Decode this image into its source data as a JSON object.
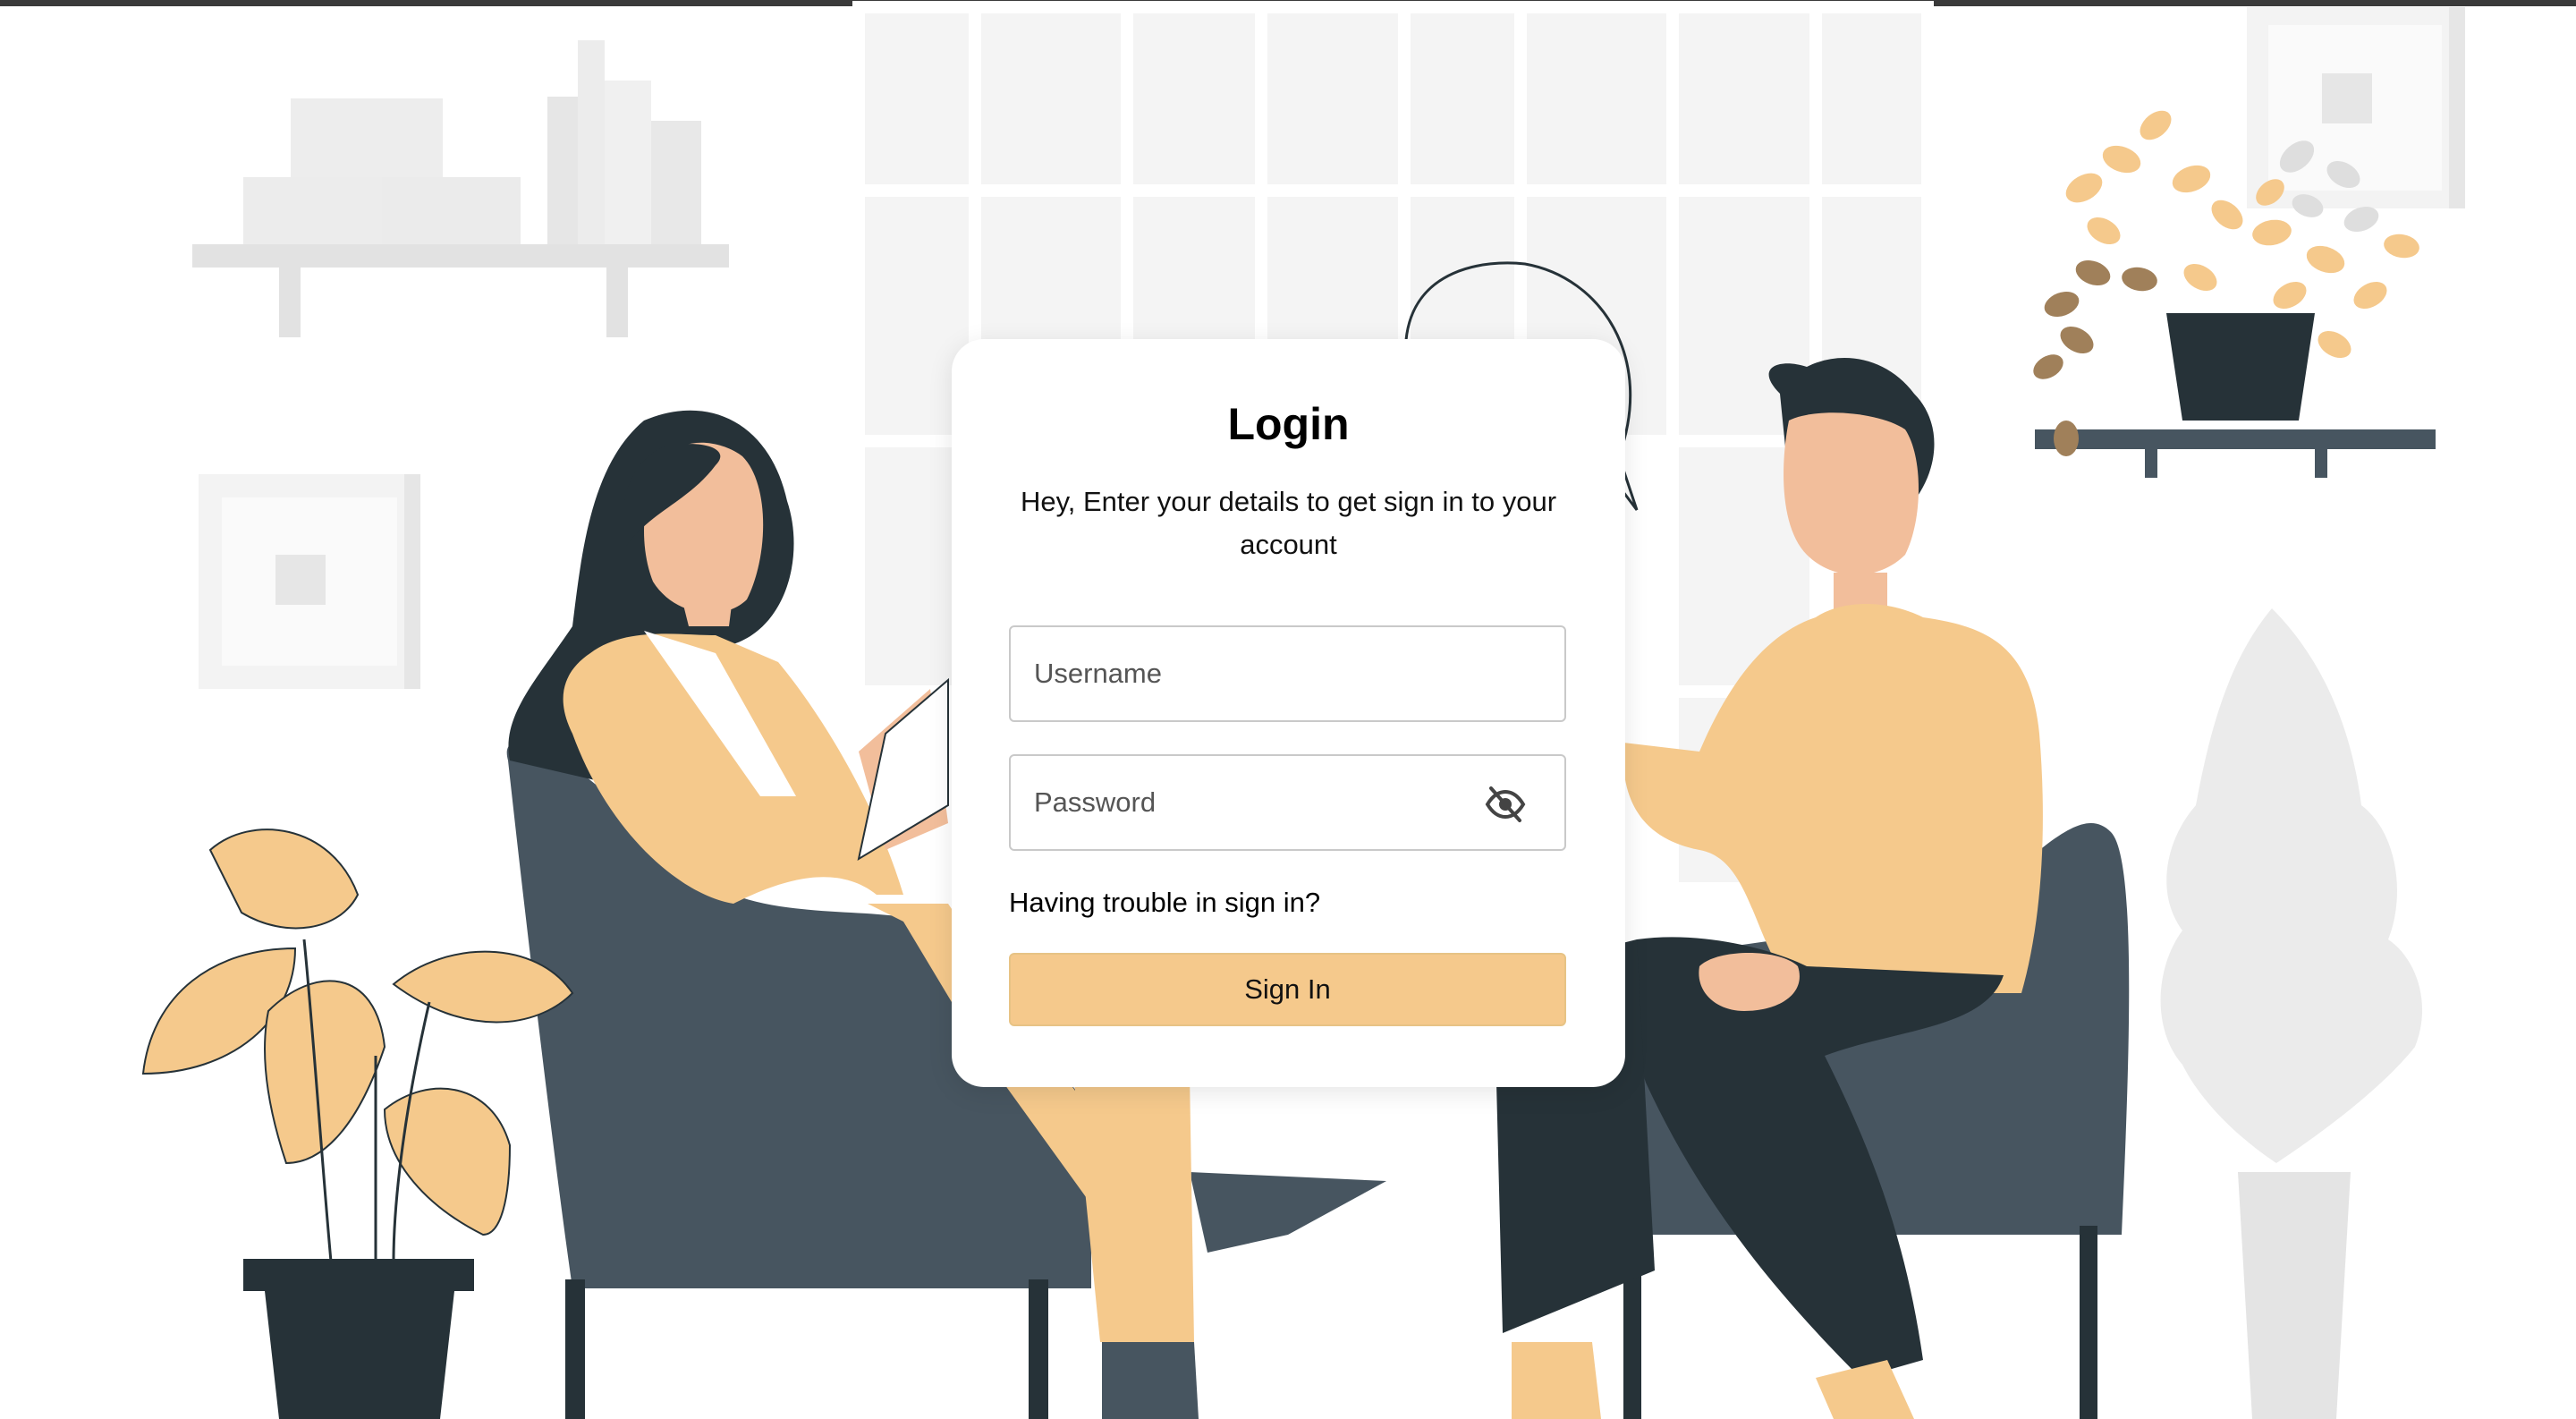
{
  "login": {
    "title": "Login",
    "subtitle": "Hey, Enter your details to get sign in to your account",
    "username_placeholder": "Username",
    "password_placeholder": "Password",
    "trouble_link": "Having trouble in sign in?",
    "signin_button": "Sign In",
    "password_toggle_icon": "eye-slash-icon"
  },
  "colors": {
    "accent": "#F5C98C",
    "dark_furniture": "#475560",
    "outline": "#263238",
    "skin": "#F2BE9B"
  }
}
